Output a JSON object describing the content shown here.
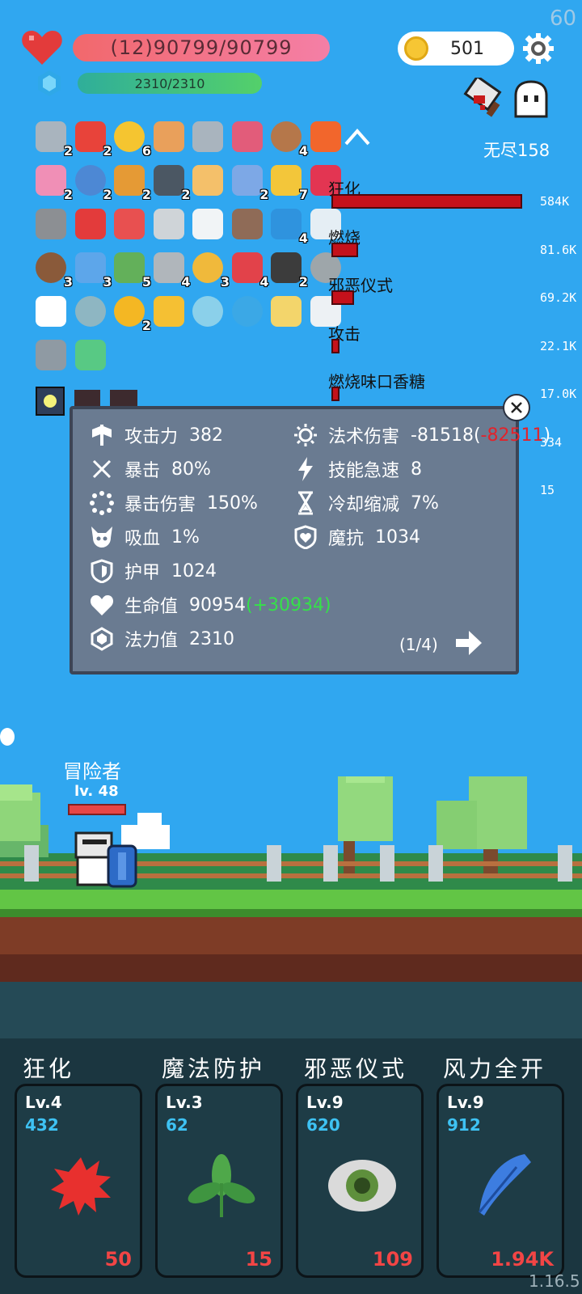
{
  "fps": "60",
  "hud": {
    "hp_text": "(12)90799/90799",
    "mana_text": "2310/2310",
    "coins": "501",
    "endless_label": "无尽158"
  },
  "items": {
    "row1": [
      {
        "icon": "sword-icon",
        "count": "2"
      },
      {
        "icon": "sock-icon",
        "count": "2"
      },
      {
        "icon": "sun-icon",
        "count": "6"
      },
      {
        "icon": "card-icon",
        "count": ""
      },
      {
        "icon": "sword-icon",
        "count": ""
      },
      {
        "icon": "jam-jar-icon",
        "count": ""
      },
      {
        "icon": "shield-round-icon",
        "count": "4"
      },
      {
        "icon": "fire-icon",
        "count": ""
      }
    ],
    "row2": [
      {
        "icon": "potion-bottle-icon",
        "count": "2"
      },
      {
        "icon": "shield-icon",
        "count": "2"
      },
      {
        "icon": "book-icon",
        "count": "2"
      },
      {
        "icon": "skull-book-icon",
        "count": "2"
      },
      {
        "icon": "glove-icon",
        "count": ""
      },
      {
        "icon": "pill-icon",
        "count": "2"
      },
      {
        "icon": "crown-icon",
        "count": "7"
      },
      {
        "icon": "ruby-icon",
        "count": ""
      }
    ],
    "row3": [
      {
        "icon": "helmet-icon",
        "count": ""
      },
      {
        "icon": "heart-icon",
        "count": ""
      },
      {
        "icon": "capsule-icon",
        "count": ""
      },
      {
        "icon": "hook-icon",
        "count": ""
      },
      {
        "icon": "cloud-icon",
        "count": ""
      },
      {
        "icon": "door-icon",
        "count": ""
      },
      {
        "icon": "chat-bubble-icon",
        "count": "4"
      },
      {
        "icon": "bulb-icon",
        "count": ""
      }
    ],
    "row4": [
      {
        "icon": "coconut-icon",
        "count": "3"
      },
      {
        "icon": "star-card-icon",
        "count": "3"
      },
      {
        "icon": "money-icon",
        "count": "5"
      },
      {
        "icon": "axe-icon",
        "count": "4"
      },
      {
        "icon": "coins-stack-icon",
        "count": "3"
      },
      {
        "icon": "watermelon-icon",
        "count": "4"
      },
      {
        "icon": "cauldron-icon",
        "count": "2"
      },
      {
        "icon": "compass-icon",
        "count": ""
      }
    ],
    "row5": [
      {
        "icon": "speech-icon",
        "count": ""
      },
      {
        "icon": "disc-icon",
        "count": ""
      },
      {
        "icon": "sunflower-icon",
        "count": "2"
      },
      {
        "icon": "magic-wand-icon",
        "count": ""
      },
      {
        "icon": "yin-yang-icon",
        "count": ""
      },
      {
        "icon": "gem-hexagon-icon",
        "count": ""
      },
      {
        "icon": "note-pencil-icon",
        "count": ""
      },
      {
        "icon": "envelope-icon",
        "count": ""
      }
    ],
    "row6": [
      {
        "icon": "mace-icon",
        "count": ""
      },
      {
        "icon": "ghost-lamp-icon",
        "count": ""
      }
    ]
  },
  "damage_stats": [
    {
      "label": "狂化",
      "value": "584K",
      "fraction": 1.0
    },
    {
      "label": "燃烧",
      "value": "81.6K",
      "fraction": 0.14
    },
    {
      "label": "邪恶仪式",
      "value": "69.2K",
      "fraction": 0.12
    },
    {
      "label": "攻击",
      "value": "22.1K",
      "fraction": 0.04
    },
    {
      "label": "燃烧味口香糖",
      "value": "17.0K",
      "fraction": 0.03
    },
    {
      "label": "",
      "value": "334",
      "fraction": 0
    },
    {
      "label": "",
      "value": "15",
      "fraction": 0
    }
  ],
  "stats_panel": {
    "attack": {
      "label": "攻击力",
      "value": "382"
    },
    "crit": {
      "label": "暴击",
      "value": "80%"
    },
    "crit_dmg": {
      "label": "暴击伤害",
      "value": "150%"
    },
    "lifesteal": {
      "label": "吸血",
      "value": "1%"
    },
    "armor": {
      "label": "护甲",
      "value": "1024"
    },
    "hp": {
      "label": "生命值",
      "value": "90954",
      "bonus": "(+30934)"
    },
    "mana": {
      "label": "法力值",
      "value": "2310"
    },
    "spell_dmg": {
      "label": "法术伤害",
      "value": "-81518",
      "bonus_open": "(",
      "bonus": "-82511",
      "bonus_close": ")"
    },
    "haste": {
      "label": "技能急速",
      "value": "8"
    },
    "cdr": {
      "label": "冷却缩减",
      "value": "7%"
    },
    "mres": {
      "label": "魔抗",
      "value": "1034"
    },
    "page": "(1/4)"
  },
  "hero": {
    "name": "冒险者",
    "level": "lv. 48",
    "hp_fraction": 1.0
  },
  "skills": [
    {
      "title": "狂化",
      "level": "Lv.4",
      "cost": "432",
      "number": "50",
      "icon": "blood-splat-icon"
    },
    {
      "title": "魔法防护",
      "level": "Lv.3",
      "cost": "62",
      "number": "15",
      "icon": "leaf-icon"
    },
    {
      "title": "邪恶仪式",
      "level": "Lv.9",
      "cost": "620",
      "number": "109",
      "icon": "eye-icon"
    },
    {
      "title": "风力全开",
      "level": "Lv.9",
      "cost": "912",
      "number": "1.94K",
      "icon": "feather-icon"
    }
  ],
  "version": "1.16.5",
  "colors": {
    "sky": "#30A7F0",
    "panel": "#6A7B91",
    "damage": "#C4111B",
    "cost": "#3EC2F3",
    "skill_number": "#F24545"
  }
}
